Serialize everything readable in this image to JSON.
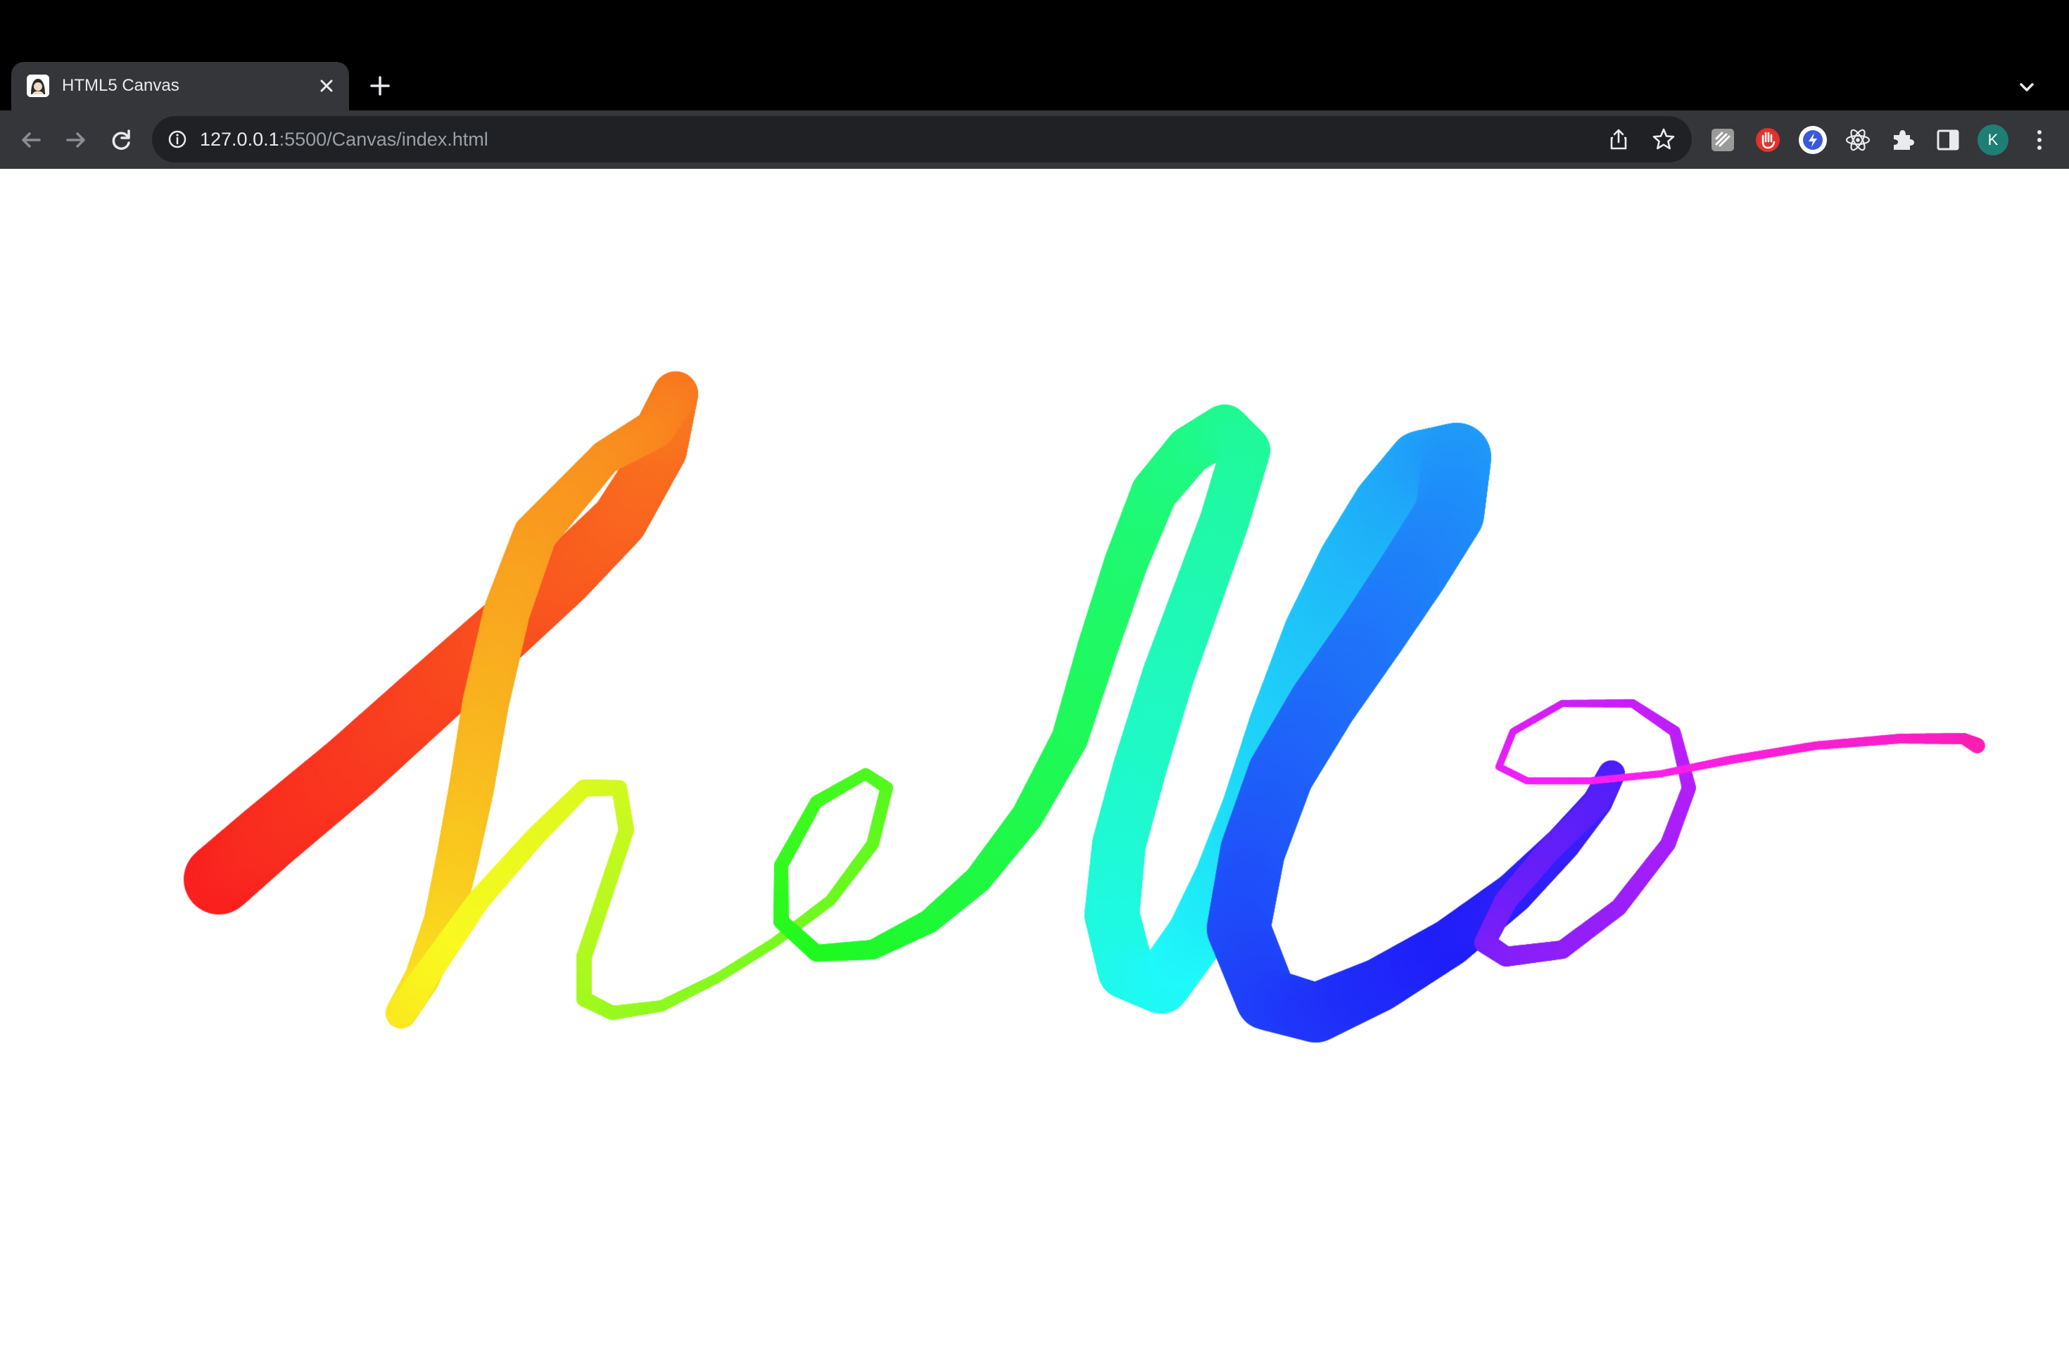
{
  "browser": {
    "tab": {
      "title": "HTML5 Canvas"
    },
    "address_bar": {
      "host": "127.0.0.1",
      "rest": ":5500/Canvas/index.html"
    },
    "profile_initial": "K"
  },
  "icons": {
    "favicon": "favicon-icon",
    "tab_close": "close-icon",
    "new_tab": "plus-icon",
    "tab_search": "chevron-down-icon",
    "back": "arrow-left-icon",
    "forward": "arrow-right-icon",
    "reload": "reload-icon",
    "site_info": "info-icon",
    "share": "share-icon",
    "bookmark": "star-icon",
    "extensions": [
      "document-extension-icon",
      "red-hand-extension-icon",
      "lightning-extension-icon",
      "react-icon",
      "puzzle-icon",
      "sidepanel-icon"
    ],
    "menu": "kebab-menu-icon"
  },
  "colors": {
    "tabstrip_bg": "#000000",
    "toolbar_bg": "#35363a",
    "omnibox_bg": "#202124",
    "page_bg": "#ffffff",
    "avatar_bg": "#1e7f74"
  }
}
